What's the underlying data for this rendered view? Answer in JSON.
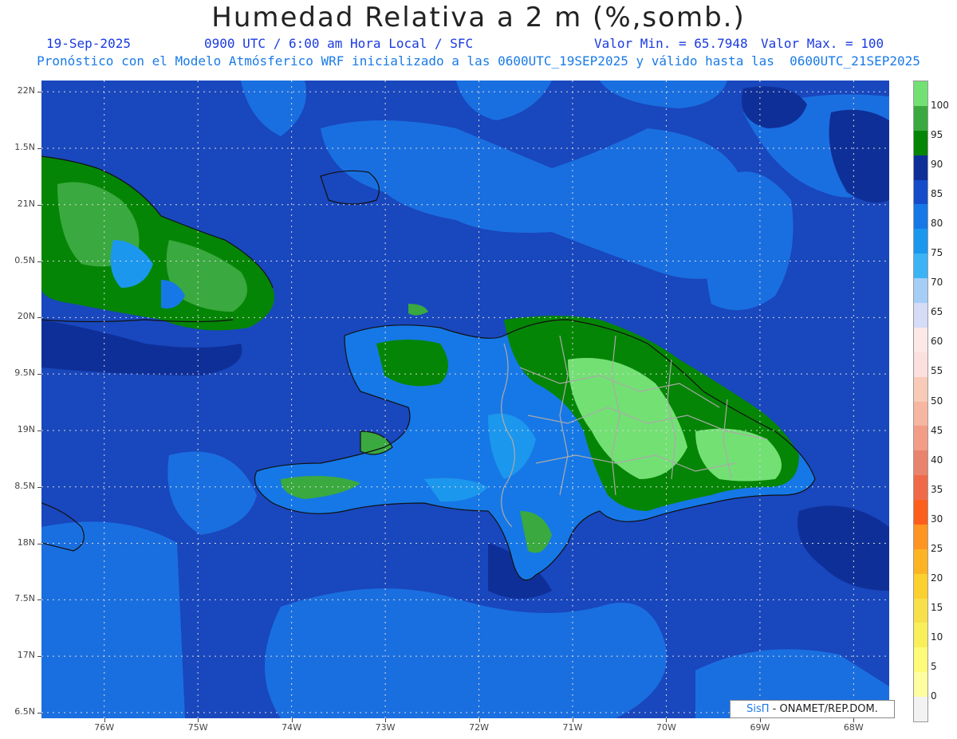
{
  "header": {
    "title": "Humedad Relativa a 2 m (%,somb.)",
    "date": "19-Sep-2025",
    "time": "0900 UTC / 6:00 am Hora Local / SFC",
    "min": "Valor Min. = 65.7948",
    "max": "Valor Max. = 100",
    "subtitle": "Pronóstico con el Modelo Atmósferico WRF inicializado a las 0600UTC_19SEP2025 y válido hasta las  0600UTC_21SEP2025"
  },
  "axes": {
    "lat_labels": [
      "22N",
      "1.5N",
      "21N",
      "0.5N",
      "20N",
      "9.5N",
      "19N",
      "8.5N",
      "18N",
      "7.5N",
      "17N",
      "6.5N"
    ],
    "lat_values": [
      22,
      21.5,
      21,
      20.5,
      20,
      19.5,
      19,
      18.5,
      18,
      17.5,
      17,
      16.5
    ],
    "lon_labels": [
      "76W",
      "75W",
      "74W",
      "73W",
      "72W",
      "71W",
      "70W",
      "69W",
      "68W"
    ],
    "lon_values": [
      -76,
      -75,
      -74,
      -73,
      -72,
      -71,
      -70,
      -69,
      -68
    ],
    "lat_range": [
      16.45,
      22.1
    ],
    "lon_range": [
      -76.67,
      -67.62
    ]
  },
  "colorbar": {
    "labels": [
      "100",
      "95",
      "90",
      "85",
      "80",
      "75",
      "70",
      "65",
      "60",
      "55",
      "50",
      "45",
      "40",
      "35",
      "30",
      "25",
      "20",
      "15",
      "10",
      "5",
      "0"
    ],
    "colors": [
      "#f2f2f2",
      "#fefea0",
      "#fdfb78",
      "#f8ef5a",
      "#f8e04a",
      "#fcd02e",
      "#fcb424",
      "#fe9421",
      "#fc5e1c",
      "#f06a4a",
      "#e8846b",
      "#f39d86",
      "#f6b6a0",
      "#f7cbb8",
      "#fbe0df",
      "#fde8e8",
      "#d6dcf7",
      "#a5cef7",
      "#3cb3f4",
      "#1c97ee",
      "#1678e6",
      "#144cc9",
      "#0f2f98",
      "#058505",
      "#3aa93f",
      "#73e074"
    ]
  },
  "credit": {
    "sis": "SisΠ",
    "org": " - ONAMET/REP.DOM."
  }
}
